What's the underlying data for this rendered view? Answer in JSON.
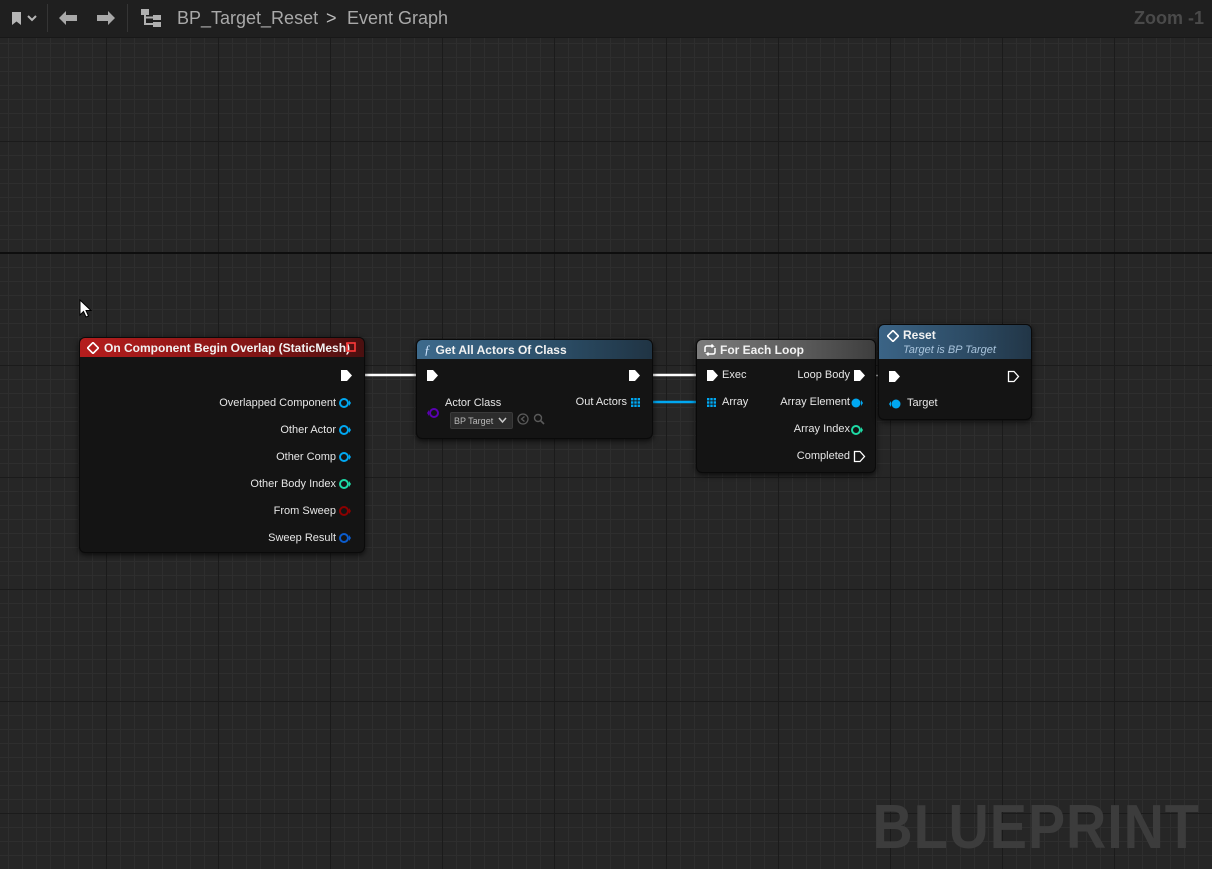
{
  "toolbar": {
    "breadcrumb_blueprint": "BP_Target_Reset",
    "breadcrumb_separator": ">",
    "breadcrumb_graph": "Event Graph",
    "zoom": "Zoom -1"
  },
  "watermark": "BLUEPRINT",
  "colors": {
    "exec": "#ffffff",
    "object": "#00a8f2",
    "integer": "#1edba6",
    "boolean": "#8c0000",
    "struct": "#0b5ccd",
    "class": "#5a00b2",
    "event_header": "#a11b1b",
    "function_header": "#3b6486",
    "macro_header": "#6d6d6d"
  },
  "nodes": {
    "event": {
      "title": "On Component Begin Overlap (StaticMesh)",
      "pins": {
        "overlapped_component": "Overlapped Component",
        "other_actor": "Other Actor",
        "other_comp": "Other Comp",
        "other_body_index": "Other Body Index",
        "from_sweep": "From Sweep",
        "sweep_result": "Sweep Result"
      }
    },
    "get_all_actors": {
      "title": "Get All Actors Of Class",
      "actor_class_label": "Actor Class",
      "actor_class_value": "BP Target",
      "out_actors_label": "Out Actors"
    },
    "for_each": {
      "title": "For Each Loop",
      "exec": "Exec",
      "array": "Array",
      "loop_body": "Loop Body",
      "array_element": "Array Element",
      "array_index": "Array Index",
      "completed": "Completed"
    },
    "reset": {
      "title": "Reset",
      "subtitle": "Target is BP Target",
      "target": "Target"
    }
  }
}
